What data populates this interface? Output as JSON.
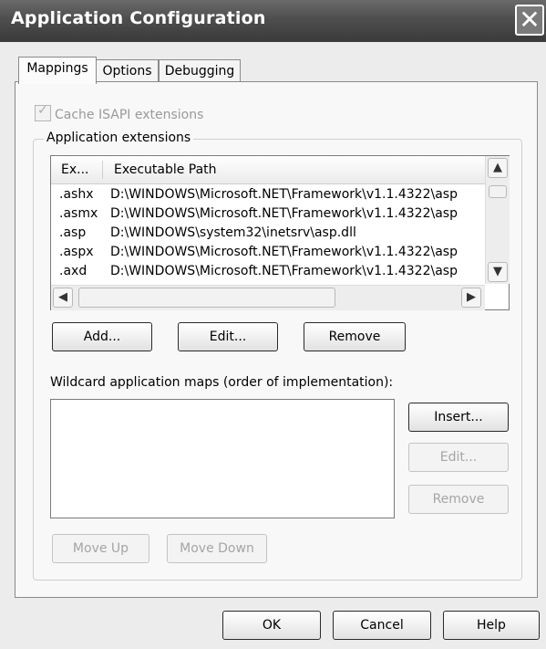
{
  "window": {
    "title": "Application Configuration",
    "close_glyph": "✕"
  },
  "tabs": [
    {
      "label": "Mappings"
    },
    {
      "label": "Options"
    },
    {
      "label": "Debugging"
    }
  ],
  "cache_isapi": {
    "label": "Cache ISAPI extensions",
    "checked": true,
    "enabled": false
  },
  "extensions_group": {
    "label": "Application extensions"
  },
  "list": {
    "columns": [
      "Ex...",
      "Executable Path"
    ],
    "rows": [
      {
        "ext": ".ashx",
        "path": "D:\\WINDOWS\\Microsoft.NET\\Framework\\v1.1.4322\\asp"
      },
      {
        "ext": ".asmx",
        "path": "D:\\WINDOWS\\Microsoft.NET\\Framework\\v1.1.4322\\asp"
      },
      {
        "ext": ".asp",
        "path": "D:\\WINDOWS\\system32\\inetsrv\\asp.dll"
      },
      {
        "ext": ".aspx",
        "path": "D:\\WINDOWS\\Microsoft.NET\\Framework\\v1.1.4322\\asp"
      },
      {
        "ext": ".axd",
        "path": "D:\\WINDOWS\\Microsoft.NET\\Framework\\v1.1.4322\\asp"
      }
    ]
  },
  "buttons": {
    "add": "Add...",
    "edit": "Edit...",
    "remove": "Remove",
    "insert": "Insert...",
    "wild_edit": "Edit...",
    "wild_remove": "Remove",
    "move_up": "Move Up",
    "move_down": "Move Down",
    "ok": "OK",
    "cancel": "Cancel",
    "help": "Help"
  },
  "wildcard": {
    "label": "Wildcard application maps (order of implementation):"
  }
}
